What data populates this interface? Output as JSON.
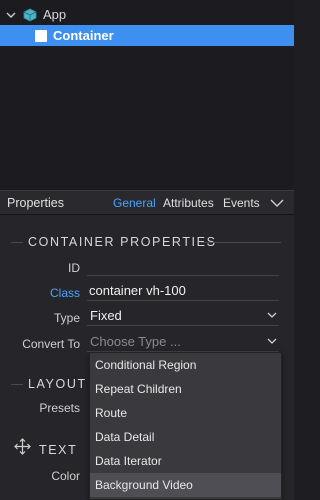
{
  "tree": {
    "app_label": "App",
    "container_label": "Container"
  },
  "properties": {
    "title": "Properties",
    "tabs": [
      {
        "label": "General",
        "active": true
      },
      {
        "label": "Attributes",
        "active": false
      },
      {
        "label": "Events",
        "active": false
      }
    ]
  },
  "container_props": {
    "section_title": "CONTAINER PROPERTIES",
    "id_label": "ID",
    "id_value": "",
    "class_label": "Class",
    "class_value": "container vh-100",
    "type_label": "Type",
    "type_value": "Fixed",
    "convert_label": "Convert To",
    "convert_placeholder": "Choose Type ..."
  },
  "layout": {
    "section_title": "LAYOUT",
    "presets_label": "Presets"
  },
  "text_section": {
    "section_title": "TEXT",
    "color_label": "Color"
  },
  "dropdown": {
    "items": [
      "Conditional Region",
      "Repeat Children",
      "Route",
      "Data Detail",
      "Data Iterator",
      "Background Video"
    ],
    "highlighted": "Background Video"
  },
  "colors": {
    "accent": "#4aa3ff",
    "selection": "#3d8ff0",
    "panel_bg": "#26262a"
  }
}
